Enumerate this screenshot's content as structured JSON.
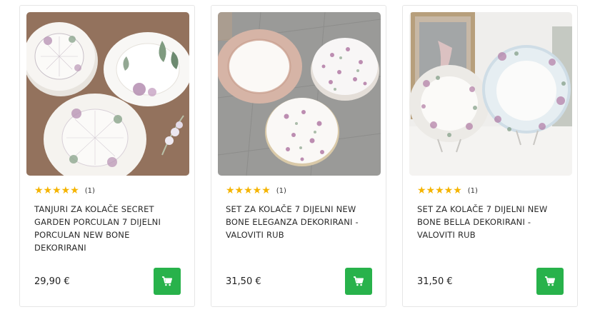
{
  "products": [
    {
      "title": "TANJURI ZA KOLAČE SECRET GARDEN PORCULAN 7 DIJELNI PORCULAN NEW BONE DEKORIRANI",
      "rating_count": "(1)",
      "stars": "★★★★★",
      "price": "29,90 €",
      "image_alt": "secret-garden-plates",
      "cart_icon": "cart-icon"
    },
    {
      "title": "SET ZA KOLAČE 7 DIJELNI NEW BONE ELEGANZA DEKORIRANI - VALOVITI RUB",
      "rating_count": "(1)",
      "stars": "★★★★★",
      "price": "31,50 €",
      "image_alt": "eleganza-plates",
      "cart_icon": "cart-icon"
    },
    {
      "title": "SET ZA KOLAČE 7 DIJELNI NEW BONE BELLA DEKORIRANI - VALOVITI RUB",
      "rating_count": "(1)",
      "stars": "★★★★★",
      "price": "31,50 €",
      "image_alt": "bella-plates",
      "cart_icon": "cart-icon"
    }
  ],
  "colors": {
    "star": "#f5b400",
    "cart_button": "#28b24b"
  }
}
